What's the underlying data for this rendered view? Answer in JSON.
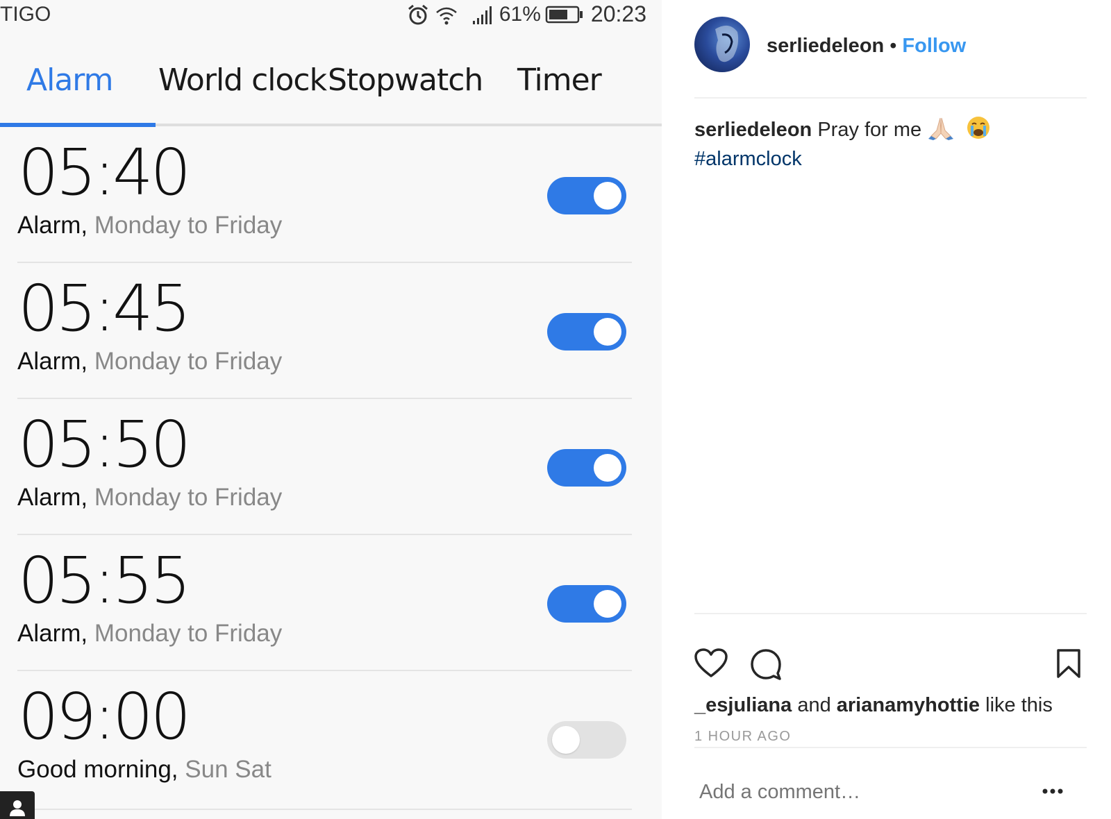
{
  "status_bar": {
    "carrier": "TIGO",
    "battery_pct": "61%",
    "time": "20:23",
    "icons": [
      "alarm-icon",
      "wifi-icon",
      "signal-icon",
      "battery-icon"
    ]
  },
  "tabs": [
    {
      "label": "Alarm",
      "active": true
    },
    {
      "label": "World clock",
      "active": false
    },
    {
      "label": "Stopwatch",
      "active": false
    },
    {
      "label": "Timer",
      "active": false
    }
  ],
  "alarms": [
    {
      "time": "05:40",
      "label": "Alarm,",
      "days": "Monday to Friday",
      "enabled": true
    },
    {
      "time": "05:45",
      "label": "Alarm,",
      "days": "Monday to Friday",
      "enabled": true
    },
    {
      "time": "05:50",
      "label": "Alarm,",
      "days": "Monday to Friday",
      "enabled": true
    },
    {
      "time": "05:55",
      "label": "Alarm,",
      "days": "Monday to Friday",
      "enabled": true
    },
    {
      "time": "09:00",
      "label": "Good morning,",
      "days": "Sun Sat",
      "enabled": false
    }
  ],
  "colors": {
    "accent": "#2f7ae6",
    "ig_link": "#3897f0",
    "ig_hashtag": "#003569"
  },
  "instagram": {
    "username": "serliedeleon",
    "separator": "•",
    "follow_label": "Follow",
    "caption_user": "serliedeleon",
    "caption_text": "Pray for me",
    "caption_emojis": [
      "folded-hands-emoji",
      "loudly-crying-face-emoji"
    ],
    "hashtag": "#alarmclock",
    "likers": [
      "_esjuliana",
      "arianamyhottie"
    ],
    "likes_and": "and",
    "likes_suffix": "like this",
    "time_ago": "1 HOUR AGO",
    "comment_placeholder": "Add a comment…",
    "action_icons": [
      "heart-icon",
      "comment-icon",
      "bookmark-icon",
      "more-options-icon"
    ]
  }
}
